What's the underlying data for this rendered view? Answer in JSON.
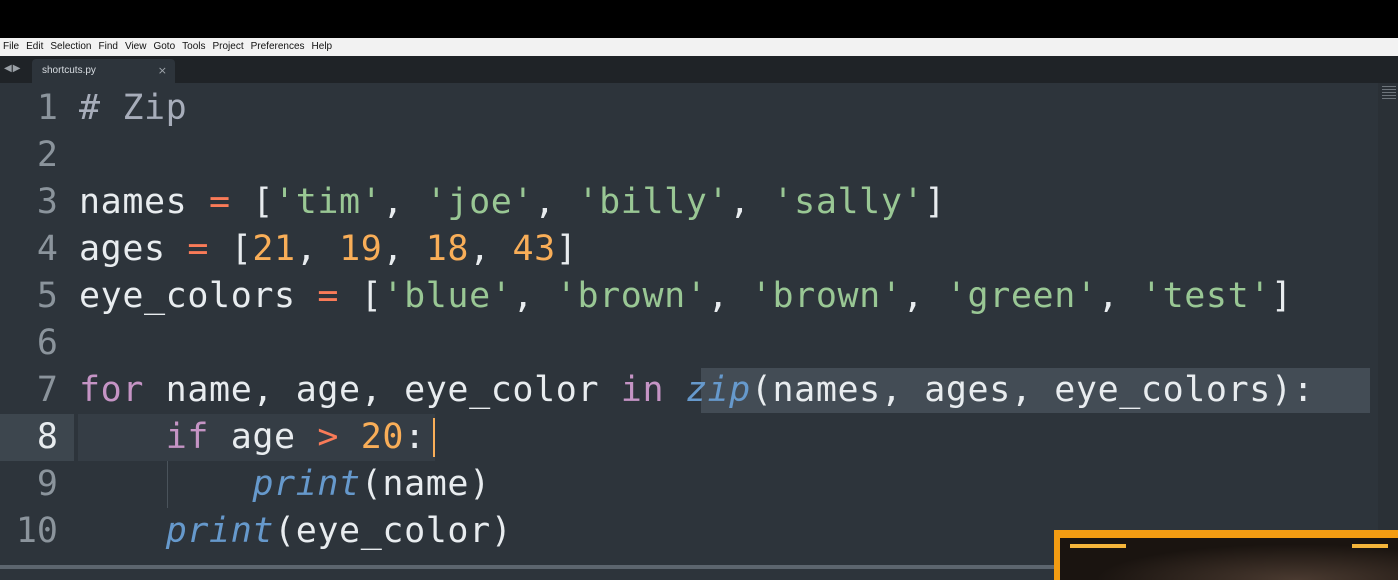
{
  "menu": [
    "File",
    "Edit",
    "Selection",
    "Find",
    "View",
    "Goto",
    "Tools",
    "Project",
    "Preferences",
    "Help"
  ],
  "tab": {
    "filename": "shortcuts.py",
    "close_glyph": "×"
  },
  "nav_icons": [
    "back-arrow-icon",
    "forward-arrow-icon"
  ],
  "editor": {
    "current_line": 8,
    "line_numbers": [
      "1",
      "2",
      "3",
      "4",
      "5",
      "6",
      "7",
      "8",
      "9",
      "10"
    ],
    "lines": {
      "l1": [
        "# Zip"
      ],
      "l3": [
        "names",
        " = ",
        "[",
        "'tim'",
        ", ",
        "'joe'",
        ", ",
        "'billy'",
        ", ",
        "'sally'",
        "]"
      ],
      "l4": [
        "ages",
        " = ",
        "[",
        "21",
        ", ",
        "19",
        ", ",
        "18",
        ", ",
        "43",
        "]"
      ],
      "l5": [
        "eye_colors",
        " = ",
        "[",
        "'blue'",
        ", ",
        "'brown'",
        ", ",
        "'brown'",
        ", ",
        "'green'",
        ", ",
        "'test'",
        "]"
      ],
      "l7": [
        "for",
        " name, age, eye_color ",
        "in",
        " ",
        "zip",
        "(names, ages, eye_colors):"
      ],
      "l8": [
        "    ",
        "if",
        " age ",
        ">",
        " ",
        "20",
        ":"
      ],
      "l9": [
        "        ",
        "print",
        "(name)"
      ],
      "l10": [
        "    ",
        "print",
        "(eye_color)"
      ]
    }
  },
  "colors": {
    "background": "#2d343b",
    "keyword": "#c594c5",
    "operator": "#f97b58",
    "string": "#99c794",
    "number": "#f9ae58",
    "function": "#6699cc",
    "webcam_border": "#f39c12"
  }
}
